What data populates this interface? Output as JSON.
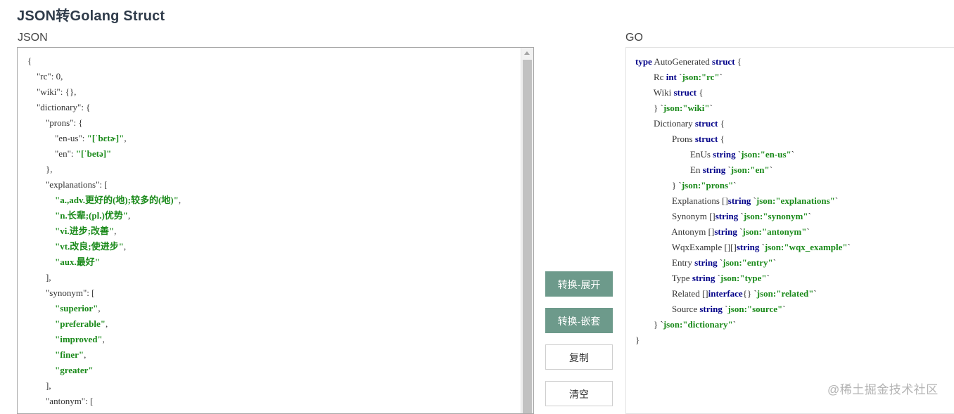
{
  "page": {
    "title": "JSON转Golang Struct"
  },
  "json_panel": {
    "label": "JSON",
    "lines": [
      [
        {
          "t": "p",
          "v": "{"
        }
      ],
      [
        {
          "t": "p",
          "v": "    \"rc\": 0,"
        }
      ],
      [
        {
          "t": "p",
          "v": "    \"wiki\": {},"
        }
      ],
      [
        {
          "t": "p",
          "v": "    \"dictionary\": {"
        }
      ],
      [
        {
          "t": "p",
          "v": "        \"prons\": {"
        }
      ],
      [
        {
          "t": "p",
          "v": "            \"en-us\": "
        },
        {
          "t": "s",
          "v": "\"[ˈbɛtɚ]\""
        },
        {
          "t": "p",
          "v": ","
        }
      ],
      [
        {
          "t": "p",
          "v": "            \"en\": "
        },
        {
          "t": "s",
          "v": "\"[ˈbetə]\""
        }
      ],
      [
        {
          "t": "p",
          "v": "        },"
        }
      ],
      [
        {
          "t": "p",
          "v": "        \"explanations\": ["
        }
      ],
      [
        {
          "t": "p",
          "v": "            "
        },
        {
          "t": "s",
          "v": "\"a.,adv.更好的(地);较多的(地)\""
        },
        {
          "t": "p",
          "v": ","
        }
      ],
      [
        {
          "t": "p",
          "v": "            "
        },
        {
          "t": "s",
          "v": "\"n.长辈;(pl.)优势\""
        },
        {
          "t": "p",
          "v": ","
        }
      ],
      [
        {
          "t": "p",
          "v": "            "
        },
        {
          "t": "s",
          "v": "\"vi.进步;改善\""
        },
        {
          "t": "p",
          "v": ","
        }
      ],
      [
        {
          "t": "p",
          "v": "            "
        },
        {
          "t": "s",
          "v": "\"vt.改良;使进步\""
        },
        {
          "t": "p",
          "v": ","
        }
      ],
      [
        {
          "t": "p",
          "v": "            "
        },
        {
          "t": "s",
          "v": "\"aux.最好\""
        }
      ],
      [
        {
          "t": "p",
          "v": "        ],"
        }
      ],
      [
        {
          "t": "p",
          "v": "        \"synonym\": ["
        }
      ],
      [
        {
          "t": "p",
          "v": "            "
        },
        {
          "t": "s",
          "v": "\"superior\""
        },
        {
          "t": "p",
          "v": ","
        }
      ],
      [
        {
          "t": "p",
          "v": "            "
        },
        {
          "t": "s",
          "v": "\"preferable\""
        },
        {
          "t": "p",
          "v": ","
        }
      ],
      [
        {
          "t": "p",
          "v": "            "
        },
        {
          "t": "s",
          "v": "\"improved\""
        },
        {
          "t": "p",
          "v": ","
        }
      ],
      [
        {
          "t": "p",
          "v": "            "
        },
        {
          "t": "s",
          "v": "\"finer\""
        },
        {
          "t": "p",
          "v": ","
        }
      ],
      [
        {
          "t": "p",
          "v": "            "
        },
        {
          "t": "s",
          "v": "\"greater\""
        }
      ],
      [
        {
          "t": "p",
          "v": "        ],"
        }
      ],
      [
        {
          "t": "p",
          "v": "        \"antonym\": ["
        }
      ]
    ]
  },
  "buttons": {
    "expand": "转换-展开",
    "nested": "转换-嵌套",
    "copy": "复制",
    "clear": "清空"
  },
  "go_panel": {
    "label": "GO",
    "lines": [
      [
        {
          "t": "k",
          "v": "type"
        },
        {
          "t": "p",
          "v": " AutoGenerated "
        },
        {
          "t": "k",
          "v": "struct"
        },
        {
          "t": "p",
          "v": " {"
        }
      ],
      [
        {
          "t": "p",
          "v": "\tRc "
        },
        {
          "t": "k",
          "v": "int"
        },
        {
          "t": "p",
          "v": " `"
        },
        {
          "t": "g",
          "v": "json:\"rc\""
        },
        {
          "t": "p",
          "v": "`"
        }
      ],
      [
        {
          "t": "p",
          "v": "\tWiki "
        },
        {
          "t": "k",
          "v": "struct"
        },
        {
          "t": "p",
          "v": " {"
        }
      ],
      [
        {
          "t": "p",
          "v": "\t} `"
        },
        {
          "t": "g",
          "v": "json:\"wiki\""
        },
        {
          "t": "p",
          "v": "`"
        }
      ],
      [
        {
          "t": "p",
          "v": "\tDictionary "
        },
        {
          "t": "k",
          "v": "struct"
        },
        {
          "t": "p",
          "v": " {"
        }
      ],
      [
        {
          "t": "p",
          "v": "\t\tProns "
        },
        {
          "t": "k",
          "v": "struct"
        },
        {
          "t": "p",
          "v": " {"
        }
      ],
      [
        {
          "t": "p",
          "v": "\t\t\tEnUs "
        },
        {
          "t": "k",
          "v": "string"
        },
        {
          "t": "p",
          "v": " `"
        },
        {
          "t": "g",
          "v": "json:\"en-us\""
        },
        {
          "t": "p",
          "v": "`"
        }
      ],
      [
        {
          "t": "p",
          "v": "\t\t\tEn "
        },
        {
          "t": "k",
          "v": "string"
        },
        {
          "t": "p",
          "v": " `"
        },
        {
          "t": "g",
          "v": "json:\"en\""
        },
        {
          "t": "p",
          "v": "`"
        }
      ],
      [
        {
          "t": "p",
          "v": "\t\t} `"
        },
        {
          "t": "g",
          "v": "json:\"prons\""
        },
        {
          "t": "p",
          "v": "`"
        }
      ],
      [
        {
          "t": "p",
          "v": "\t\tExplanations []"
        },
        {
          "t": "k",
          "v": "string"
        },
        {
          "t": "p",
          "v": " `"
        },
        {
          "t": "g",
          "v": "json:\"explanations\""
        },
        {
          "t": "p",
          "v": "`"
        }
      ],
      [
        {
          "t": "p",
          "v": "\t\tSynonym []"
        },
        {
          "t": "k",
          "v": "string"
        },
        {
          "t": "p",
          "v": " `"
        },
        {
          "t": "g",
          "v": "json:\"synonym\""
        },
        {
          "t": "p",
          "v": "`"
        }
      ],
      [
        {
          "t": "p",
          "v": "\t\tAntonym []"
        },
        {
          "t": "k",
          "v": "string"
        },
        {
          "t": "p",
          "v": " `"
        },
        {
          "t": "g",
          "v": "json:\"antonym\""
        },
        {
          "t": "p",
          "v": "`"
        }
      ],
      [
        {
          "t": "p",
          "v": "\t\tWqxExample [][]"
        },
        {
          "t": "k",
          "v": "string"
        },
        {
          "t": "p",
          "v": " `"
        },
        {
          "t": "g",
          "v": "json:\"wqx_example\""
        },
        {
          "t": "p",
          "v": "`"
        }
      ],
      [
        {
          "t": "p",
          "v": "\t\tEntry "
        },
        {
          "t": "k",
          "v": "string"
        },
        {
          "t": "p",
          "v": " `"
        },
        {
          "t": "g",
          "v": "json:\"entry\""
        },
        {
          "t": "p",
          "v": "`"
        }
      ],
      [
        {
          "t": "p",
          "v": "\t\tType "
        },
        {
          "t": "k",
          "v": "string"
        },
        {
          "t": "p",
          "v": " `"
        },
        {
          "t": "g",
          "v": "json:\"type\""
        },
        {
          "t": "p",
          "v": "`"
        }
      ],
      [
        {
          "t": "p",
          "v": "\t\tRelated []"
        },
        {
          "t": "k",
          "v": "interface"
        },
        {
          "t": "p",
          "v": "{} `"
        },
        {
          "t": "g",
          "v": "json:\"related\""
        },
        {
          "t": "p",
          "v": "`"
        }
      ],
      [
        {
          "t": "p",
          "v": "\t\tSource "
        },
        {
          "t": "k",
          "v": "string"
        },
        {
          "t": "p",
          "v": " `"
        },
        {
          "t": "g",
          "v": "json:\"source\""
        },
        {
          "t": "p",
          "v": "`"
        }
      ],
      [
        {
          "t": "p",
          "v": "\t} `"
        },
        {
          "t": "g",
          "v": "json:\"dictionary\""
        },
        {
          "t": "p",
          "v": "`"
        }
      ],
      [
        {
          "t": "p",
          "v": "}"
        }
      ]
    ]
  },
  "watermark": "@稀土掘金技术社区",
  "colors": {
    "primary_button": "#6d9a8b",
    "json_string": "#1a8a1a",
    "go_keyword": "#000088",
    "go_tag": "#1a8a1a"
  }
}
